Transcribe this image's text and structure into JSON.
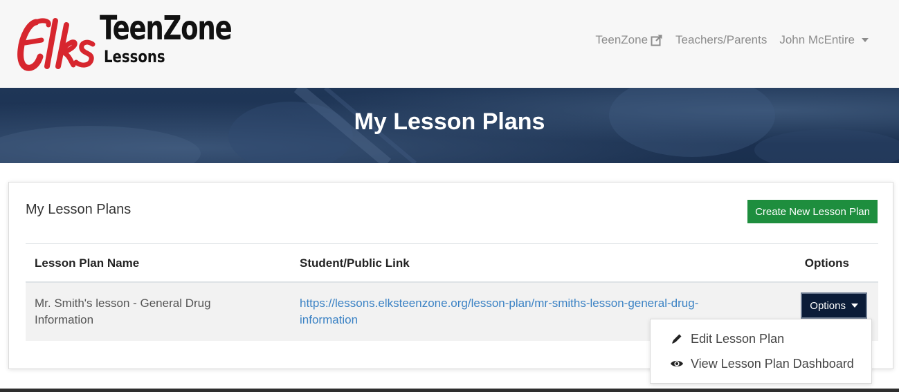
{
  "brand": {
    "logo_script": "Elks",
    "logo_title": "TeenZone",
    "logo_subtitle": "Lessons",
    "logo_color": "#d7262e"
  },
  "nav": {
    "teenzone": "TeenZone",
    "teenzone_icon": "external-link-icon",
    "teachers_parents": "Teachers/Parents",
    "user": "John McEntire"
  },
  "hero": {
    "title": "My Lesson Plans"
  },
  "card": {
    "title": "My Lesson Plans",
    "create_button": "Create New Lesson Plan",
    "create_button_color": "#1e8e3e"
  },
  "table": {
    "headers": {
      "name": "Lesson Plan Name",
      "link": "Student/Public Link",
      "options": "Options"
    },
    "rows": [
      {
        "name": "Mr. Smith's lesson - General Drug Information",
        "link": "https://lessons.elksteenzone.org/lesson-plan/mr-smiths-lesson-general-drug-information",
        "options_label": "Options"
      }
    ]
  },
  "options_menu": {
    "items": [
      {
        "label": "Edit Lesson Plan",
        "icon": "pencil-icon"
      },
      {
        "label": "View Lesson Plan Dashboard",
        "icon": "eye-icon"
      }
    ]
  },
  "colors": {
    "hero_bg": "#1f3657",
    "options_button_bg": "#0b1c38",
    "link": "#3b82c4"
  }
}
